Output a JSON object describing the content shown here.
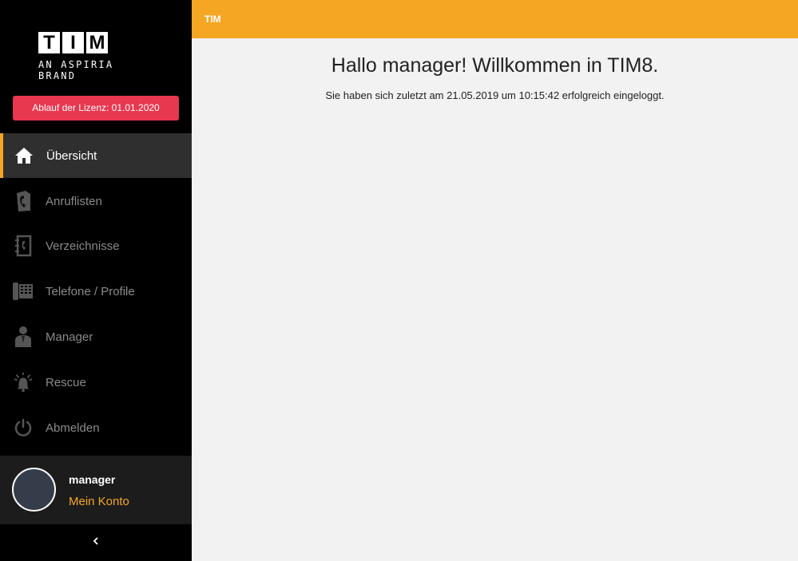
{
  "brand": {
    "letters": [
      "T",
      "I",
      "M"
    ],
    "tagline": "AN ASPIRIA BRAND"
  },
  "license": {
    "label": "Ablauf der Lizenz: 01.01.2020"
  },
  "nav": {
    "items": [
      {
        "label": "Übersicht",
        "icon": "home-icon",
        "active": true
      },
      {
        "label": "Anruflisten",
        "icon": "call-list-icon"
      },
      {
        "label": "Verzeichnisse",
        "icon": "phonebook-icon"
      },
      {
        "label": "Telefone / Profile",
        "icon": "desk-phone-icon"
      },
      {
        "label": "Manager",
        "icon": "manager-icon"
      },
      {
        "label": "Rescue",
        "icon": "alarm-bell-icon"
      },
      {
        "label": "Abmelden",
        "icon": "power-icon"
      }
    ]
  },
  "user": {
    "name": "manager",
    "account_link": "Mein Konto"
  },
  "topbar": {
    "title": "TIM"
  },
  "main": {
    "welcome": "Hallo manager! Willkommen in TIM8.",
    "last_login": "Sie haben sich zuletzt am 21.05.2019 um 10:15:42 erfolgreich eingeloggt."
  },
  "colors": {
    "accent": "#f5a623",
    "sidebar": "#000000",
    "license_badge": "#e8384f",
    "background": "#f2f2f2"
  }
}
